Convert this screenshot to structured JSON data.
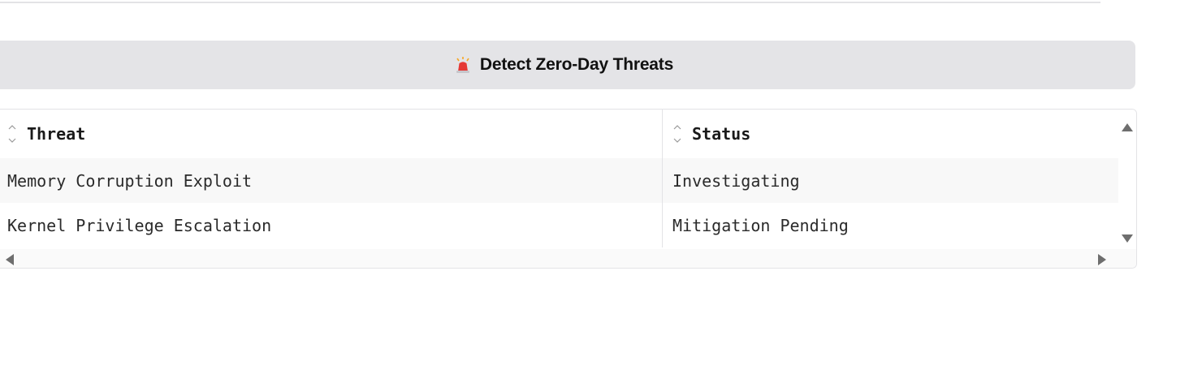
{
  "action": {
    "icon": "rotating-light-icon",
    "label": "Detect Zero-Day Threats"
  },
  "table": {
    "columns": [
      "Threat",
      "Status"
    ],
    "rows": [
      [
        "Memory Corruption Exploit",
        "Investigating"
      ],
      [
        "Kernel Privilege Escalation",
        "Mitigation Pending"
      ]
    ]
  },
  "colors": {
    "button_bg": "#e4e4e7",
    "border": "#e3e3e6",
    "alarm_red": "#e53935"
  }
}
